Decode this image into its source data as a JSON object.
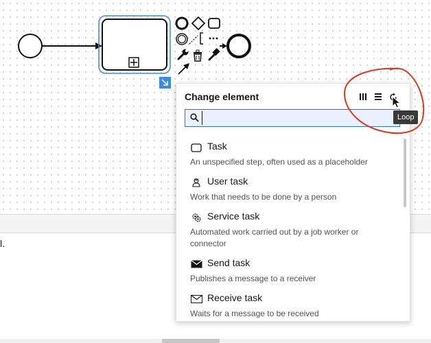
{
  "popup": {
    "title": "Change element",
    "search_value": "",
    "items": [
      {
        "icon": "task-icon",
        "label": "Task",
        "description": "An unspecified step, often used as a placeholder"
      },
      {
        "icon": "user-task-icon",
        "label": "User task",
        "description": "Work that needs to be done by a person"
      },
      {
        "icon": "service-task-icon",
        "label": "Service task",
        "description": "Automated work carried out by a job worker or connector"
      },
      {
        "icon": "send-task-icon",
        "label": "Send task",
        "description": "Publishes a message to a receiver"
      },
      {
        "icon": "receive-task-icon",
        "label": "Receive task",
        "description": "Waits for a message to be received"
      }
    ]
  },
  "tooltip": {
    "text": "Loop"
  },
  "bottom": {
    "text": "l."
  }
}
